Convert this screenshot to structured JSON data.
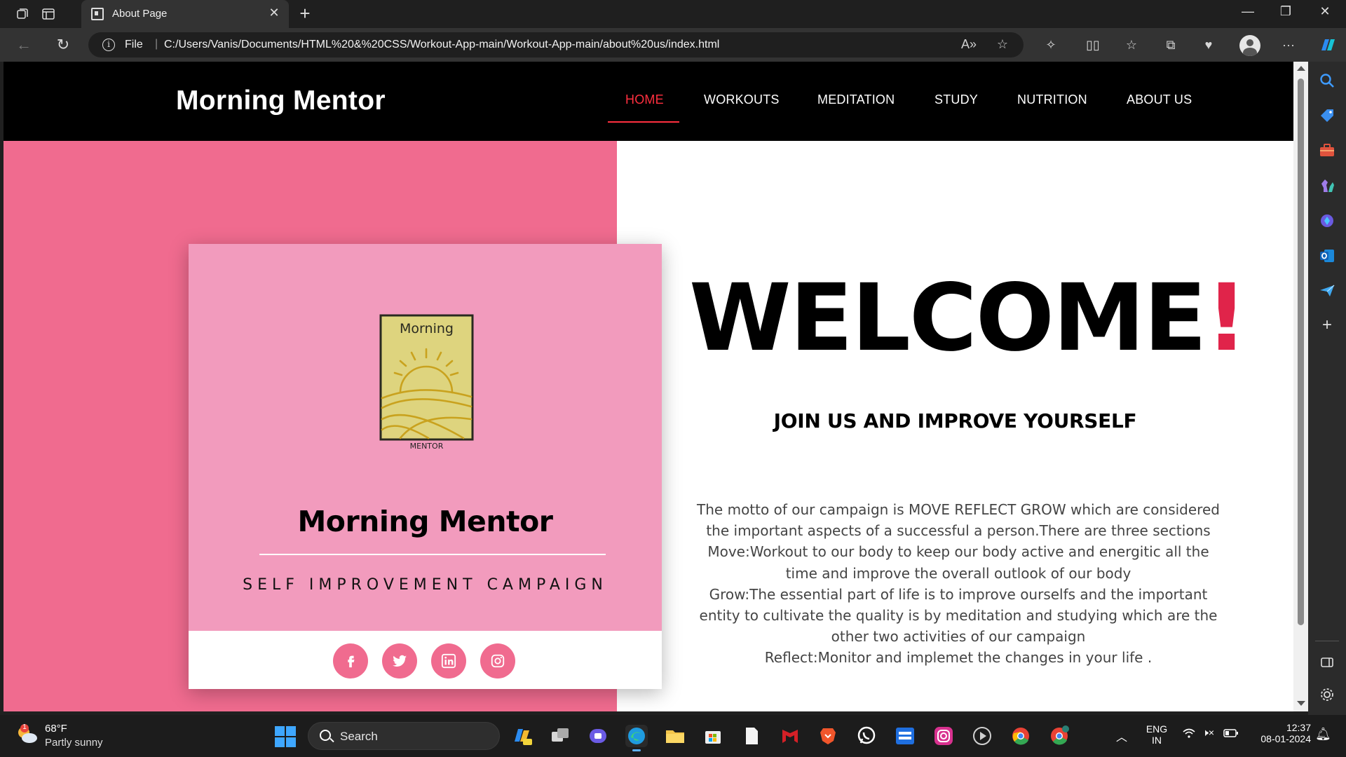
{
  "browser": {
    "tab_title": "About Page",
    "address_prefix": "File",
    "url": "C:/Users/Vanis/Documents/HTML%20&%20CSS/Workout-App-main/Workout-App-main/about%20us/index.html"
  },
  "site": {
    "logo": "Morning Mentor",
    "nav": [
      "HOME",
      "WORKOUTS",
      "MEDITATION",
      "STUDY",
      "NUTRITION",
      "ABOUT US"
    ],
    "active_nav": "HOME"
  },
  "card": {
    "logo_word": "Morning",
    "logo_caption": "MENTOR",
    "title": "Morning Mentor",
    "subtitle": "SELF IMPROVEMENT CAMPAIGN",
    "socials": [
      "facebook-icon",
      "twitter-icon",
      "linkedin-icon",
      "instagram-icon"
    ]
  },
  "hero": {
    "welcome": "WELCOME",
    "bang": "!",
    "tagline": "JOIN US AND IMPROVE YOURSELF",
    "motto": [
      "The motto of our campaign is MOVE REFLECT GROW which are considered the important aspects of a successful a person.There are three sections",
      "Move:Workout to our body to keep our body active and energitic all the time and improve the overall outlook of our body",
      "Grow:The essential part of life is to improve ourselfs and the important entity to cultivate the quality is by meditation and studying which are the other two activities of our campaign",
      "Reflect:Monitor and implemet the changes in your life ."
    ]
  },
  "colors": {
    "pink_panel": "#f06b8f",
    "card_pink": "#f29bbd",
    "accent_red": "#ff2f3f",
    "bang_red": "#e0244a"
  },
  "taskbar": {
    "weather_badge": "1",
    "temperature": "68°F",
    "condition": "Partly sunny",
    "search_label": "Search",
    "lang_top": "ENG",
    "lang_bottom": "IN",
    "time": "12:37",
    "date": "08-01-2024"
  }
}
